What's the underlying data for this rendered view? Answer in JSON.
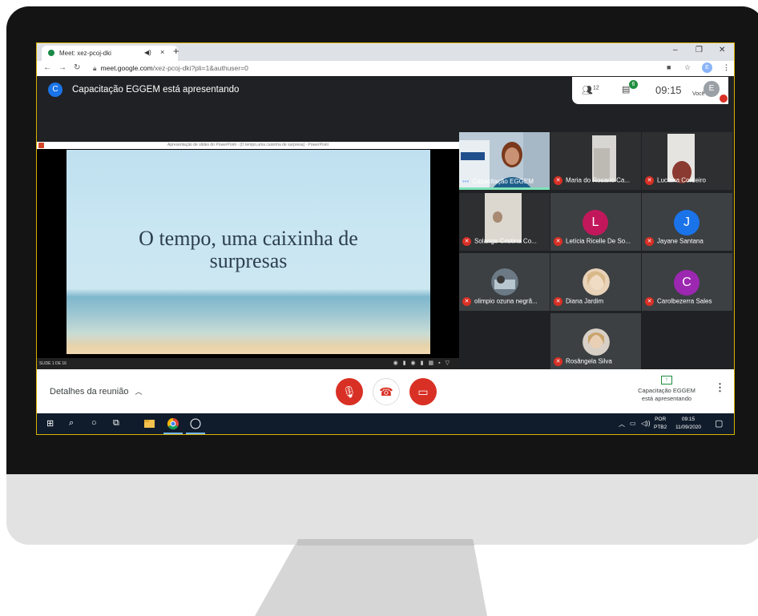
{
  "browser": {
    "tab_title": "Meet: xez-pcoj-dki",
    "tab_close": "×",
    "new_tab": "+",
    "url_host": "meet.google.com",
    "url_path": "/xez-pcoj-dki?pli=1&authuser=0",
    "account_initial": "E"
  },
  "meet": {
    "presenter_initial": "C",
    "presenting_title": "Capacitação EGGEM está apresentando",
    "people_count": "12",
    "chat_count": "6",
    "time": "09:15",
    "you_label": "Você",
    "you_initial": "E"
  },
  "presentation": {
    "window_title": "Apresentação de slides do PowerPoint - [O tempo,uma caixinha de surpresa] - PowerPoint",
    "slide_line1": "O tempo, uma caixinha de",
    "slide_line2": "surpresas",
    "slide_counter": "SLIDE 1 DE 16"
  },
  "participants": [
    {
      "name": "Capacitação EGGEM",
      "kind": "video",
      "muted": false,
      "active": true
    },
    {
      "name": "Maria do Rosario Ca...",
      "kind": "video",
      "muted": true
    },
    {
      "name": "Luciana Cordeiro",
      "kind": "video",
      "muted": true
    },
    {
      "name": "Solange Cristina Co...",
      "kind": "video",
      "muted": true
    },
    {
      "name": "Letícia Ricelle De So...",
      "kind": "initial",
      "initial": "L",
      "color": "#c2185b",
      "muted": true
    },
    {
      "name": "Jayane Santana",
      "kind": "initial",
      "initial": "J",
      "color": "#1a73e8",
      "muted": true
    },
    {
      "name": "olimpio ozuna negrã...",
      "kind": "photo",
      "muted": true
    },
    {
      "name": "Diana Jardim",
      "kind": "photo",
      "muted": true
    },
    {
      "name": "Carolbezerra Sales",
      "kind": "initial",
      "initial": "C",
      "color": "#9c27b0",
      "muted": true
    },
    {
      "name": "Rosângela Silva",
      "kind": "photo",
      "muted": true
    }
  ],
  "bottom": {
    "details_label": "Detalhes da reunião",
    "presenting_line1": "Capacitação EGGEM",
    "presenting_line2": "está apresentando"
  },
  "taskbar": {
    "lang1": "POR",
    "lang2": "PTB2",
    "clock_time": "09:15",
    "clock_date": "11/09/2020"
  },
  "colors": {
    "meet_bg": "#202124",
    "hangup_red": "#d93025",
    "active_speaker": "#7de3b8"
  }
}
